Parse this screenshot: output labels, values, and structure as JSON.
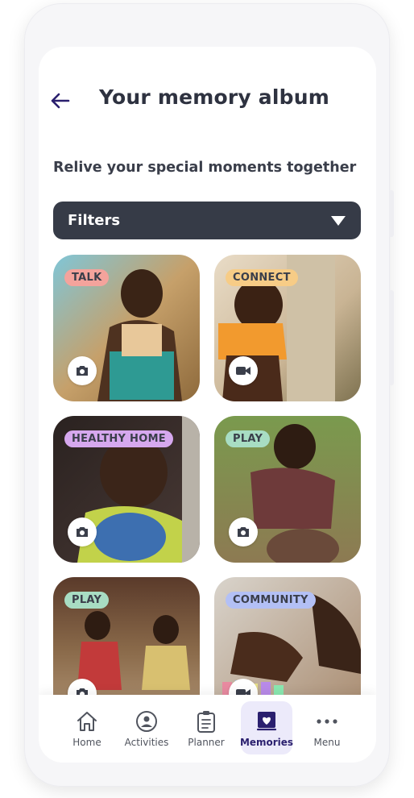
{
  "header": {
    "title": "Your memory album",
    "back_icon": "back-arrow-icon"
  },
  "subtitle": "Relive your special moments together",
  "filters": {
    "label": "Filters",
    "icon": "chevron-down-icon"
  },
  "cards": [
    {
      "tag": "TALK",
      "tag_color": "#f4a39c",
      "media": "camera-icon"
    },
    {
      "tag": "CONNECT",
      "tag_color": "#f7cc86",
      "media": "video-icon"
    },
    {
      "tag": "HEALTHY HOME",
      "tag_color": "#d6a8ee",
      "media": "camera-icon"
    },
    {
      "tag": "PLAY",
      "tag_color": "#a8ddc3",
      "media": "camera-icon"
    },
    {
      "tag": "PLAY",
      "tag_color": "#a8ddc3",
      "media": "camera-icon"
    },
    {
      "tag": "COMMUNITY",
      "tag_color": "#b3c0f5",
      "media": "video-icon"
    }
  ],
  "nav": [
    {
      "label": "Home",
      "icon": "home-icon"
    },
    {
      "label": "Activities",
      "icon": "activities-icon"
    },
    {
      "label": "Planner",
      "icon": "clipboard-icon"
    },
    {
      "label": "Memories",
      "icon": "memories-icon",
      "active": true
    },
    {
      "label": "Menu",
      "icon": "more-icon"
    }
  ],
  "colors": {
    "accent": "#2a1f6e",
    "filters_bg": "#363b47",
    "active_nav_bg": "#eceafa"
  }
}
